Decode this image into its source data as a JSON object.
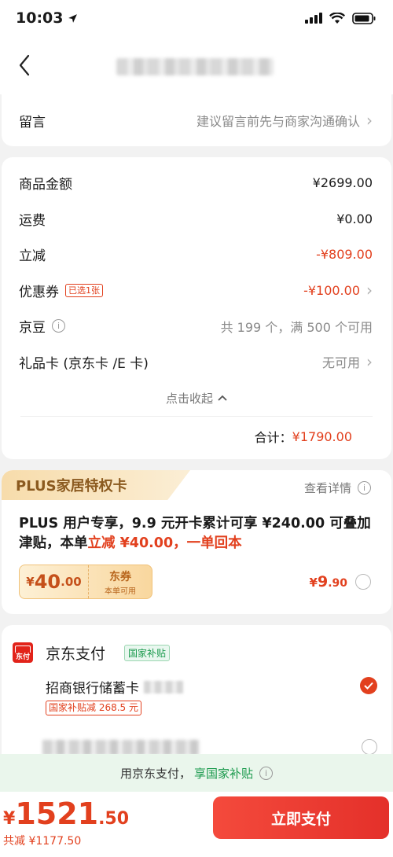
{
  "status_bar": {
    "time": "10:03"
  },
  "remark": {
    "label": "留言",
    "hint": "建议留言前先与商家沟通确认"
  },
  "amounts": {
    "goods_label": "商品金额",
    "goods_value": "¥2699.00",
    "shipping_label": "运费",
    "shipping_value": "¥0.00",
    "discount_label": "立减",
    "discount_value": "-¥809.00",
    "coupon_label": "优惠券",
    "coupon_tag": "已选1张",
    "coupon_value": "-¥100.00",
    "jingdou_label": "京豆",
    "jingdou_value": "共 199 个，满 500 个可用",
    "giftcard_label": "礼品卡 (京东卡 /E 卡)",
    "giftcard_value": "无可用",
    "collapse_label": "点击收起",
    "total_label": "合计：",
    "total_value": "¥1790.00"
  },
  "plus": {
    "tag": "PLUS家居特权卡",
    "detail": "查看详情",
    "desc_black": "PLUS 用户专享，9.9 元开卡累计可享 ¥240.00 可叠加津贴，本单",
    "desc_red": "立减 ¥40.00，一单回本",
    "coupon_symbol": "¥",
    "coupon_amount": "40",
    "coupon_decimal": ".00",
    "coupon_title": "东券",
    "coupon_sub": "本单可用",
    "price_symbol": "¥",
    "price_int": "9",
    "price_dec": ".90"
  },
  "payment": {
    "logo_text": "东付",
    "title": "京东支付",
    "gov_tag": "国家补贴",
    "bank": "招商银行储蓄卡",
    "subsidy_tag": "国家补贴减 268.5 元"
  },
  "promo": {
    "text": "用京东支付，",
    "highlight": "享国家补贴"
  },
  "bottom": {
    "symbol": "¥",
    "price_int": "1521",
    "price_dec": ".50",
    "saved": "共减 ¥1177.50",
    "pay_button": "立即支付"
  }
}
